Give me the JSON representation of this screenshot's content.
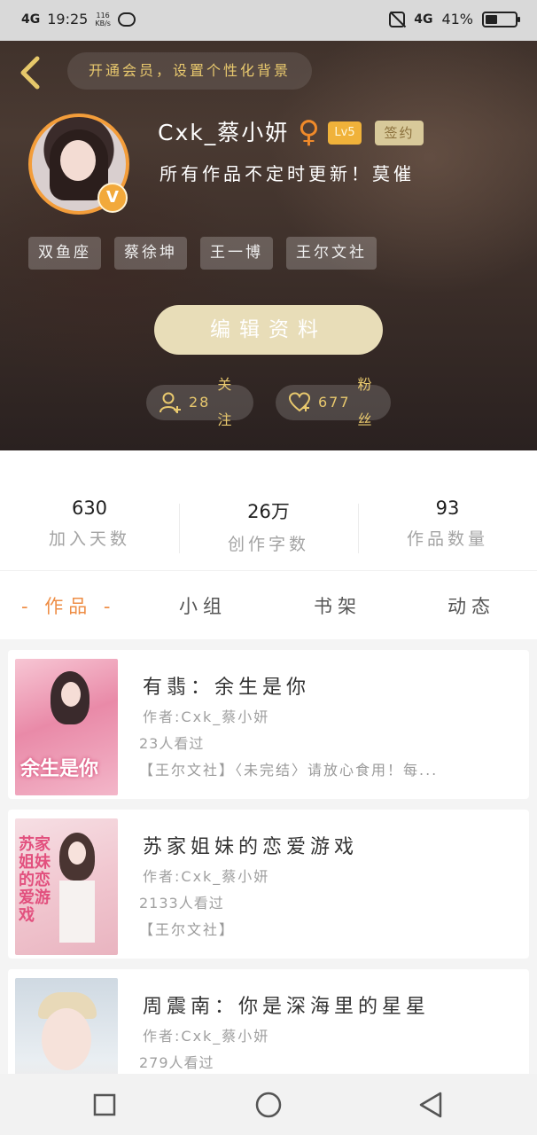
{
  "status_bar": {
    "network_left": "4G",
    "time": "19:25",
    "speed_value": "116",
    "speed_unit": "KB/s",
    "network_right": "4G",
    "battery": "41%",
    "battery_level": 0.41
  },
  "header": {
    "vip_banner": "开通会员，设置个性化背景",
    "username": "Cxk_蔡小妍",
    "gender_symbol": "♀",
    "level": "Lv5",
    "signed_badge": "签约",
    "motto": "所有作品不定时更新！莫催",
    "verified_badge": "V",
    "tags": [
      "双鱼座",
      "蔡徐坤",
      "王一博",
      "王尔文社"
    ],
    "edit_button": "编辑资料",
    "follow_count": "28",
    "follow_label": "关注",
    "fans_count": "677",
    "fans_label": "粉丝"
  },
  "stats": [
    {
      "value": "630",
      "label": "加入天数"
    },
    {
      "value": "26万",
      "label": "创作字数"
    },
    {
      "value": "93",
      "label": "作品数量"
    }
  ],
  "tabs": [
    {
      "label": "- 作品 -",
      "active": true
    },
    {
      "label": "小组",
      "active": false
    },
    {
      "label": "书架",
      "active": false
    },
    {
      "label": "动态",
      "active": false
    }
  ],
  "books": [
    {
      "title": "有翡：余生是你",
      "author": "作者:Cxk_蔡小妍",
      "views": "23人看过",
      "desc": "【王尔文社】〈未完结〉请放心食用！每...",
      "cover_text": "余生是你"
    },
    {
      "title": "苏家姐妹的恋爱游戏",
      "author": "作者:Cxk_蔡小妍",
      "views": "2133人看过",
      "desc": "【王尔文社】",
      "cover_text": "苏家姐妹的恋爱游戏"
    },
    {
      "title": "周震南：你是深海里的星星",
      "author": "作者:Cxk_蔡小妍",
      "views": "279人看过",
      "desc": "",
      "cover_text": ""
    }
  ],
  "colors": {
    "accent_orange": "#ee8d45",
    "gold_text": "#e9c96e",
    "edit_button_bg": "#e8ddb8"
  }
}
